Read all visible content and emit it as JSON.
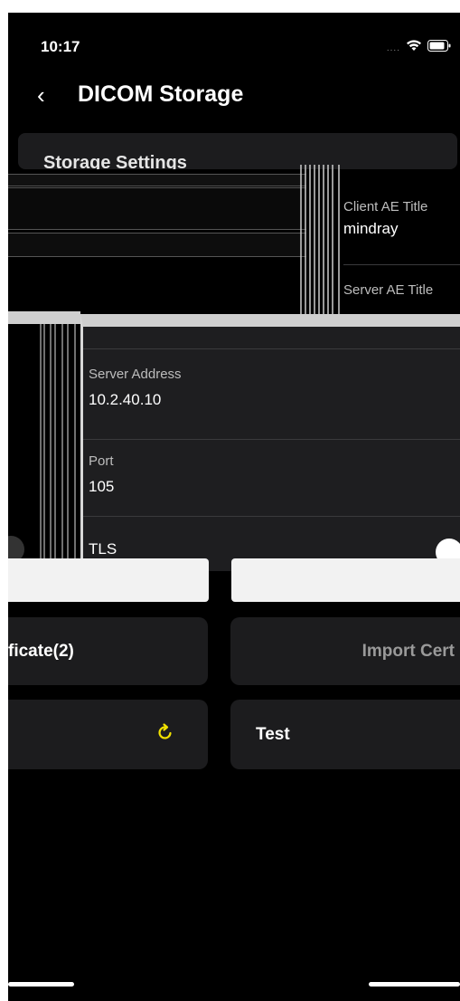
{
  "status_bar": {
    "time": "10:17",
    "signal": "....",
    "wifi_icon": "wifi-icon",
    "battery_icon": "battery-icon"
  },
  "nav": {
    "back_icon": "chevron-left-icon",
    "title": "DICOM Storage"
  },
  "storage_settings": {
    "header": "Storage Settings"
  },
  "fields": {
    "client_ae_title": {
      "label": "Client AE Title",
      "value": "mindray"
    },
    "server_ae_title": {
      "label": "Server AE Title"
    },
    "server_address": {
      "label": "Server Address",
      "value": "10.2.40.10"
    },
    "port": {
      "label": "Port",
      "value": "105"
    },
    "tls": {
      "label": "TLS"
    }
  },
  "buttons": {
    "certificate": "ficate(2)",
    "import_cert": "Import Cert",
    "refresh_icon": "refresh-icon",
    "test": "Test"
  },
  "colors": {
    "background": "#000000",
    "card": "#1c1c1e",
    "refresh_accent": "#f0e000"
  }
}
